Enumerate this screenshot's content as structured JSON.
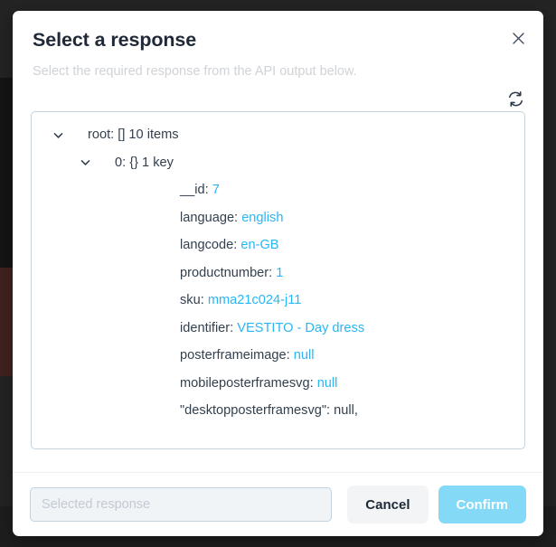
{
  "dialog": {
    "title": "Select a response",
    "subtitle": "Select the required response from the API output below.",
    "close_icon": "close-icon",
    "refresh_icon": "refresh-icon"
  },
  "tree": {
    "rows": [
      {
        "level": 0,
        "caret": "chevron-down-icon",
        "key": "root:",
        "meta": "[] 10 items",
        "value": null,
        "raw": false
      },
      {
        "level": 1,
        "caret": "chevron-down-icon",
        "key": "0:",
        "meta": "{} 1 key",
        "value": null,
        "raw": false
      },
      {
        "level": 2,
        "caret": null,
        "key": "__id:",
        "meta": null,
        "value": "7",
        "raw": false
      },
      {
        "level": 2,
        "caret": null,
        "key": "language:",
        "meta": null,
        "value": "english",
        "raw": false
      },
      {
        "level": 2,
        "caret": null,
        "key": "langcode:",
        "meta": null,
        "value": "en-GB",
        "raw": false
      },
      {
        "level": 2,
        "caret": null,
        "key": "productnumber:",
        "meta": null,
        "value": "1",
        "raw": false
      },
      {
        "level": 2,
        "caret": null,
        "key": "sku:",
        "meta": null,
        "value": "mma21c024-j11",
        "raw": false
      },
      {
        "level": 2,
        "caret": null,
        "key": "identifier:",
        "meta": null,
        "value": "VESTITO - Day dress",
        "raw": false
      },
      {
        "level": 2,
        "caret": null,
        "key": "posterframeimage:",
        "meta": null,
        "value": "null",
        "raw": false
      },
      {
        "level": 2,
        "caret": null,
        "key": "mobileposterframesvg:",
        "meta": null,
        "value": "null",
        "raw": false
      },
      {
        "level": 2,
        "caret": null,
        "key": "\"desktopposterframesvg\":",
        "meta": null,
        "value": "null,",
        "raw": true
      }
    ]
  },
  "footer": {
    "selected_value": "",
    "selected_placeholder": "Selected response",
    "cancel_label": "Cancel",
    "confirm_label": "Confirm"
  },
  "colors": {
    "value_blue": "#29b6f6",
    "key_dark": "#33404e",
    "confirm_blue": "#84d9f7",
    "panel_border": "#c3d2dc",
    "subtitle_gray": "#cfd3d8"
  }
}
